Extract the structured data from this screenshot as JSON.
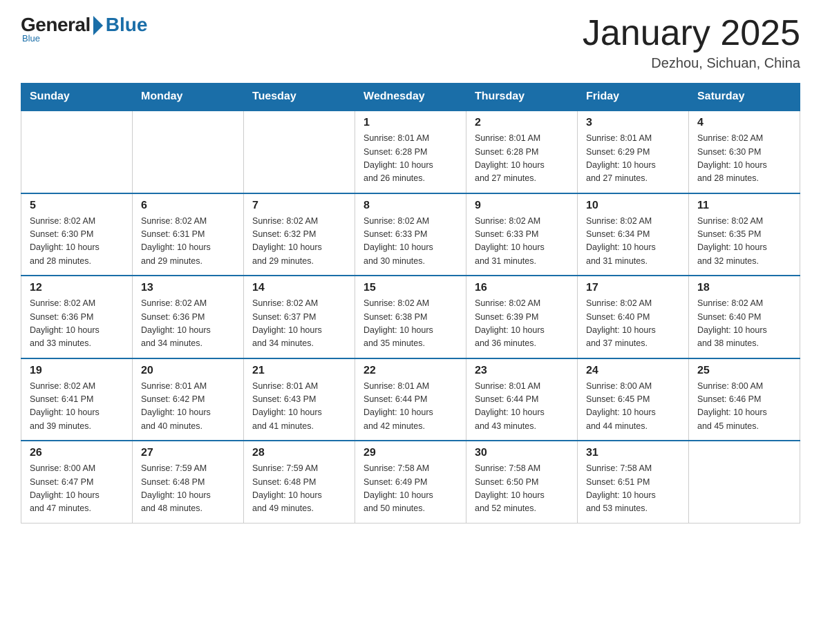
{
  "logo": {
    "general": "General",
    "blue": "Blue",
    "subtitle": "Blue"
  },
  "header": {
    "title": "January 2025",
    "location": "Dezhou, Sichuan, China"
  },
  "weekdays": [
    "Sunday",
    "Monday",
    "Tuesday",
    "Wednesday",
    "Thursday",
    "Friday",
    "Saturday"
  ],
  "weeks": [
    [
      {
        "day": "",
        "info": ""
      },
      {
        "day": "",
        "info": ""
      },
      {
        "day": "",
        "info": ""
      },
      {
        "day": "1",
        "info": "Sunrise: 8:01 AM\nSunset: 6:28 PM\nDaylight: 10 hours\nand 26 minutes."
      },
      {
        "day": "2",
        "info": "Sunrise: 8:01 AM\nSunset: 6:28 PM\nDaylight: 10 hours\nand 27 minutes."
      },
      {
        "day": "3",
        "info": "Sunrise: 8:01 AM\nSunset: 6:29 PM\nDaylight: 10 hours\nand 27 minutes."
      },
      {
        "day": "4",
        "info": "Sunrise: 8:02 AM\nSunset: 6:30 PM\nDaylight: 10 hours\nand 28 minutes."
      }
    ],
    [
      {
        "day": "5",
        "info": "Sunrise: 8:02 AM\nSunset: 6:30 PM\nDaylight: 10 hours\nand 28 minutes."
      },
      {
        "day": "6",
        "info": "Sunrise: 8:02 AM\nSunset: 6:31 PM\nDaylight: 10 hours\nand 29 minutes."
      },
      {
        "day": "7",
        "info": "Sunrise: 8:02 AM\nSunset: 6:32 PM\nDaylight: 10 hours\nand 29 minutes."
      },
      {
        "day": "8",
        "info": "Sunrise: 8:02 AM\nSunset: 6:33 PM\nDaylight: 10 hours\nand 30 minutes."
      },
      {
        "day": "9",
        "info": "Sunrise: 8:02 AM\nSunset: 6:33 PM\nDaylight: 10 hours\nand 31 minutes."
      },
      {
        "day": "10",
        "info": "Sunrise: 8:02 AM\nSunset: 6:34 PM\nDaylight: 10 hours\nand 31 minutes."
      },
      {
        "day": "11",
        "info": "Sunrise: 8:02 AM\nSunset: 6:35 PM\nDaylight: 10 hours\nand 32 minutes."
      }
    ],
    [
      {
        "day": "12",
        "info": "Sunrise: 8:02 AM\nSunset: 6:36 PM\nDaylight: 10 hours\nand 33 minutes."
      },
      {
        "day": "13",
        "info": "Sunrise: 8:02 AM\nSunset: 6:36 PM\nDaylight: 10 hours\nand 34 minutes."
      },
      {
        "day": "14",
        "info": "Sunrise: 8:02 AM\nSunset: 6:37 PM\nDaylight: 10 hours\nand 34 minutes."
      },
      {
        "day": "15",
        "info": "Sunrise: 8:02 AM\nSunset: 6:38 PM\nDaylight: 10 hours\nand 35 minutes."
      },
      {
        "day": "16",
        "info": "Sunrise: 8:02 AM\nSunset: 6:39 PM\nDaylight: 10 hours\nand 36 minutes."
      },
      {
        "day": "17",
        "info": "Sunrise: 8:02 AM\nSunset: 6:40 PM\nDaylight: 10 hours\nand 37 minutes."
      },
      {
        "day": "18",
        "info": "Sunrise: 8:02 AM\nSunset: 6:40 PM\nDaylight: 10 hours\nand 38 minutes."
      }
    ],
    [
      {
        "day": "19",
        "info": "Sunrise: 8:02 AM\nSunset: 6:41 PM\nDaylight: 10 hours\nand 39 minutes."
      },
      {
        "day": "20",
        "info": "Sunrise: 8:01 AM\nSunset: 6:42 PM\nDaylight: 10 hours\nand 40 minutes."
      },
      {
        "day": "21",
        "info": "Sunrise: 8:01 AM\nSunset: 6:43 PM\nDaylight: 10 hours\nand 41 minutes."
      },
      {
        "day": "22",
        "info": "Sunrise: 8:01 AM\nSunset: 6:44 PM\nDaylight: 10 hours\nand 42 minutes."
      },
      {
        "day": "23",
        "info": "Sunrise: 8:01 AM\nSunset: 6:44 PM\nDaylight: 10 hours\nand 43 minutes."
      },
      {
        "day": "24",
        "info": "Sunrise: 8:00 AM\nSunset: 6:45 PM\nDaylight: 10 hours\nand 44 minutes."
      },
      {
        "day": "25",
        "info": "Sunrise: 8:00 AM\nSunset: 6:46 PM\nDaylight: 10 hours\nand 45 minutes."
      }
    ],
    [
      {
        "day": "26",
        "info": "Sunrise: 8:00 AM\nSunset: 6:47 PM\nDaylight: 10 hours\nand 47 minutes."
      },
      {
        "day": "27",
        "info": "Sunrise: 7:59 AM\nSunset: 6:48 PM\nDaylight: 10 hours\nand 48 minutes."
      },
      {
        "day": "28",
        "info": "Sunrise: 7:59 AM\nSunset: 6:48 PM\nDaylight: 10 hours\nand 49 minutes."
      },
      {
        "day": "29",
        "info": "Sunrise: 7:58 AM\nSunset: 6:49 PM\nDaylight: 10 hours\nand 50 minutes."
      },
      {
        "day": "30",
        "info": "Sunrise: 7:58 AM\nSunset: 6:50 PM\nDaylight: 10 hours\nand 52 minutes."
      },
      {
        "day": "31",
        "info": "Sunrise: 7:58 AM\nSunset: 6:51 PM\nDaylight: 10 hours\nand 53 minutes."
      },
      {
        "day": "",
        "info": ""
      }
    ]
  ]
}
